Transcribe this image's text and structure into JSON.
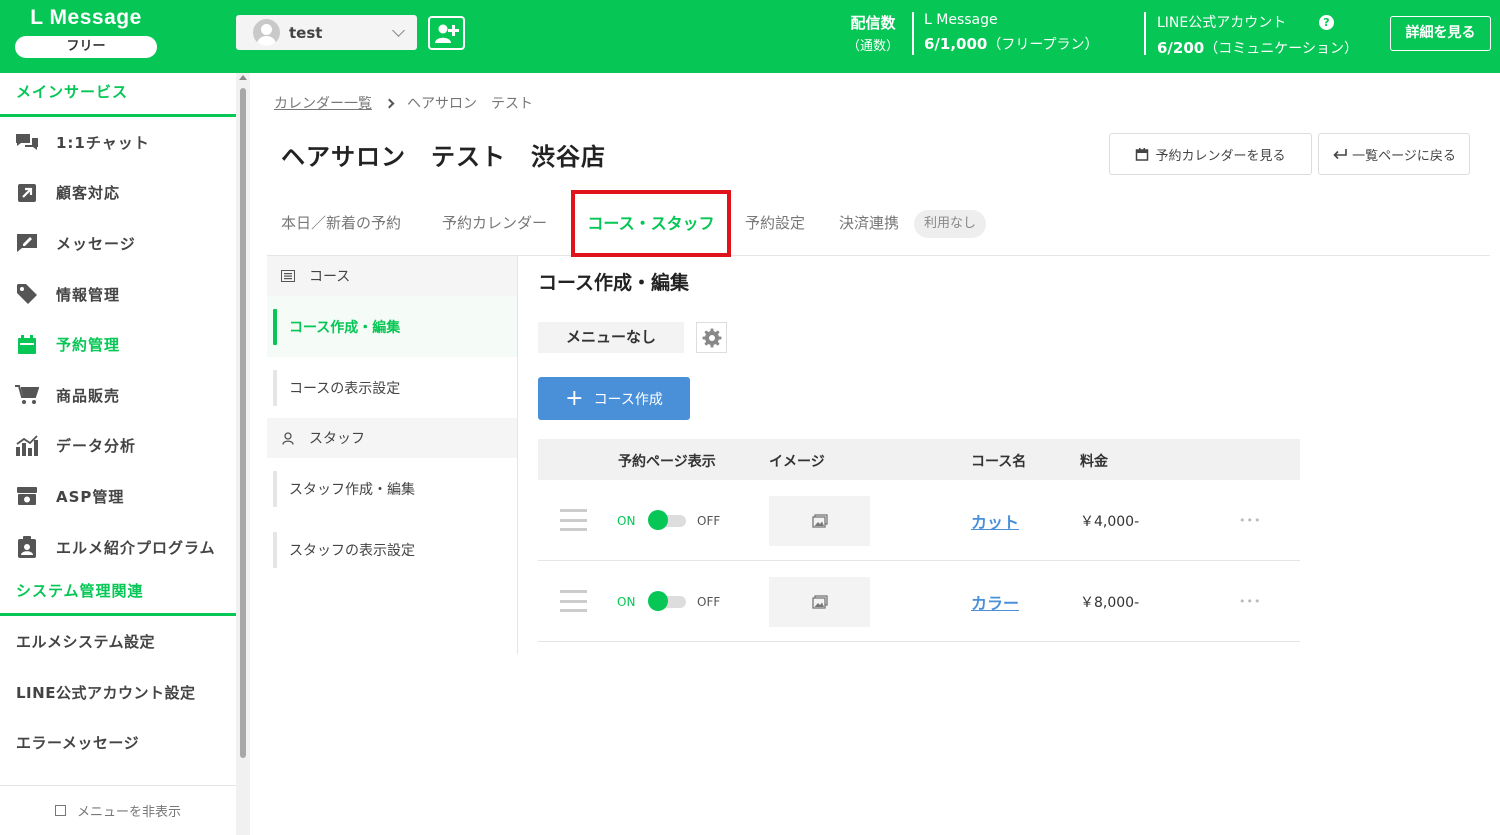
{
  "header": {
    "brand": "L Message",
    "plan": "フリー",
    "account_name": "test",
    "delivery_label": "配信数",
    "delivery_sub": "（通数）",
    "lmessage_label": "L Message",
    "lmessage_count": "6/1,000",
    "lmessage_plan": "（フリープラン）",
    "line_label": "LINE公式アカウント",
    "line_count": "6/200",
    "line_plan": "（コミュニケーション）",
    "help": "?",
    "details_button": "詳細を見る"
  },
  "sidebar": {
    "main_section": "メインサービス",
    "items": [
      {
        "label": "1:1チャット",
        "icon": "chat-icon"
      },
      {
        "label": "顧客対応",
        "icon": "arrow-up-right-icon"
      },
      {
        "label": "メッセージ",
        "icon": "message-edit-icon"
      },
      {
        "label": "情報管理",
        "icon": "tag-icon"
      },
      {
        "label": "予約管理",
        "icon": "calendar-icon"
      },
      {
        "label": "商品販売",
        "icon": "cart-icon"
      },
      {
        "label": "データ分析",
        "icon": "chart-icon"
      },
      {
        "label": "ASP管理",
        "icon": "asp-icon"
      },
      {
        "label": "エルメ紹介プログラム",
        "icon": "clipboard-user-icon"
      }
    ],
    "system_section": "システム管理関連",
    "system_items": [
      "エルメシステム設定",
      "LINE公式アカウント設定",
      "エラーメッセージ"
    ],
    "hide_menu": "メニューを非表示"
  },
  "breadcrumb": {
    "link": "カレンダー一覧",
    "current": "ヘアサロン　テスト"
  },
  "page": {
    "title": "ヘアサロン　テスト　渋谷店",
    "view_calendar_button": "予約カレンダーを見る",
    "back_button": "一覧ページに戻る"
  },
  "tabs": {
    "today": "本日／新着の予約",
    "calendar": "予約カレンダー",
    "course_staff": "コース・スタッフ",
    "settings": "予約設定",
    "payment": "決済連携",
    "payment_badge": "利用なし"
  },
  "subnav": {
    "course_head": "コース",
    "course_edit": "コース作成・編集",
    "course_display": "コースの表示設定",
    "staff_head": "スタッフ",
    "staff_edit": "スタッフ作成・編集",
    "staff_display": "スタッフの表示設定"
  },
  "content": {
    "section_title": "コース作成・編集",
    "menu_chip": "メニューなし",
    "create_button": "コース作成",
    "columns": {
      "display": "予約ページ表示",
      "image": "イメージ",
      "name": "コース名",
      "price": "料金"
    },
    "rows": [
      {
        "on": "ON",
        "off": "OFF",
        "name": "カット",
        "price": "￥4,000-",
        "more": "•••"
      },
      {
        "on": "ON",
        "off": "OFF",
        "name": "カラー",
        "price": "￥8,000-",
        "more": "•••"
      }
    ]
  },
  "colors": {
    "brand_green": "#06c755",
    "highlight_red": "#e0121b",
    "button_blue": "#4a90d9"
  }
}
